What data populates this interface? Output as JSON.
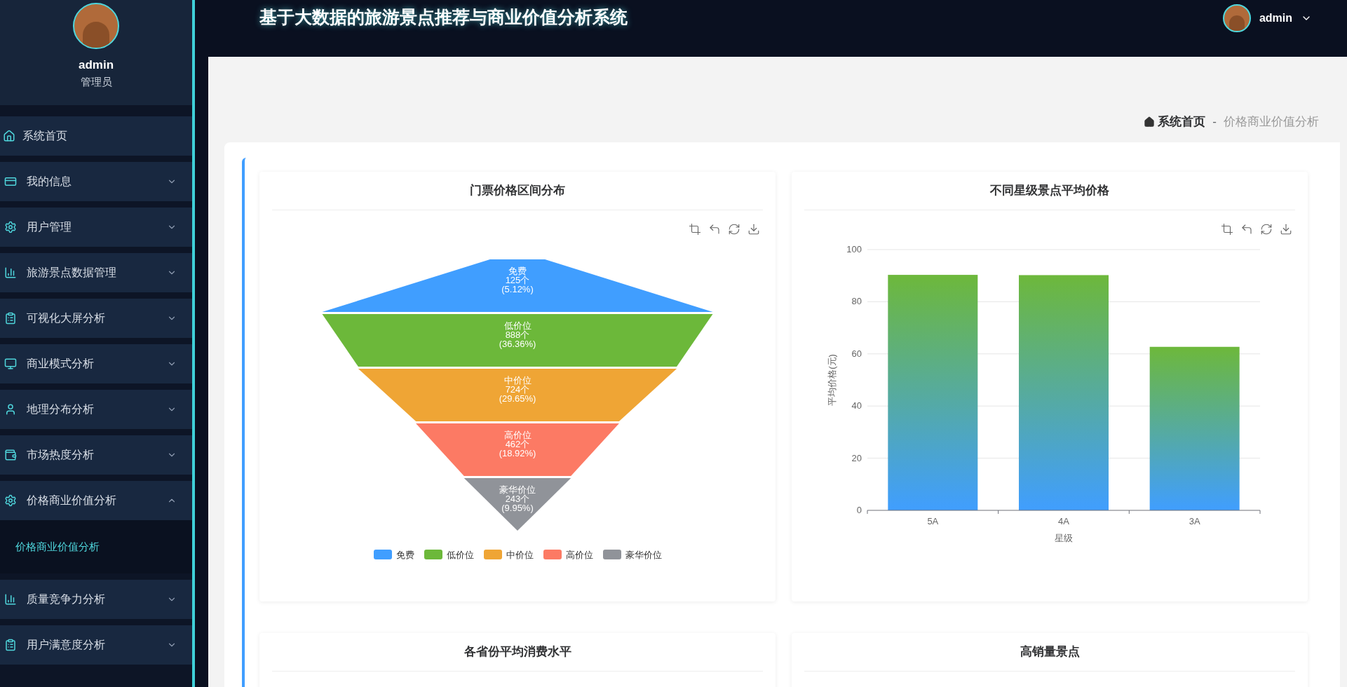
{
  "header": {
    "title": "基于大数据的旅游景点推荐与商业价值分析系统",
    "user": "admin"
  },
  "sidebar": {
    "user_name": "admin",
    "role": "管理员",
    "items": [
      {
        "label": "系统首页",
        "kind": "link"
      },
      {
        "label": "我的信息",
        "kind": "menu",
        "expanded": false
      },
      {
        "label": "用户管理",
        "kind": "menu",
        "expanded": false
      },
      {
        "label": "旅游景点数据管理",
        "kind": "menu",
        "expanded": false
      },
      {
        "label": "可视化大屏分析",
        "kind": "menu",
        "expanded": false
      },
      {
        "label": "商业模式分析",
        "kind": "menu",
        "expanded": false
      },
      {
        "label": "地理分布分析",
        "kind": "menu",
        "expanded": false
      },
      {
        "label": "市场热度分析",
        "kind": "menu",
        "expanded": false
      },
      {
        "label": "价格商业价值分析",
        "kind": "menu",
        "expanded": true,
        "children": [
          {
            "label": "价格商业价值分析",
            "selected": true
          }
        ]
      },
      {
        "label": "质量竞争力分析",
        "kind": "menu",
        "expanded": false
      },
      {
        "label": "用户满意度分析",
        "kind": "menu",
        "expanded": false
      }
    ]
  },
  "breadcrumb": {
    "home": "系统首页",
    "separator": "-",
    "current": "价格商业价值分析"
  },
  "panels": [
    {
      "kind": "funnel",
      "title": "门票价格区间分布",
      "funnel": [
        {
          "label": "免费",
          "count": "125个",
          "percent": "(5.12%)",
          "color": "#409eff"
        },
        {
          "label": "低价位",
          "count": "888个",
          "percent": "(36.36%)",
          "color": "#6cb83a"
        },
        {
          "label": "中价位",
          "count": "724个",
          "percent": "(29.65%)",
          "color": "#efa535"
        },
        {
          "label": "高价位",
          "count": "462个",
          "percent": "(18.92%)",
          "color": "#fc7a64"
        },
        {
          "label": "豪华价位",
          "count": "243个",
          "percent": "(9.95%)",
          "color": "#909399"
        }
      ],
      "legend": [
        {
          "label": "免费",
          "color": "#409eff"
        },
        {
          "label": "低价位",
          "color": "#6cb83a"
        },
        {
          "label": "中价位",
          "color": "#efa535"
        },
        {
          "label": "高价位",
          "color": "#fc7a64"
        },
        {
          "label": "豪华价位",
          "color": "#909399"
        }
      ]
    },
    {
      "kind": "bar",
      "title": "不同星级景点平均价格",
      "chart_data": {
        "type": "bar",
        "xlabel": "星级",
        "ylabel": "平均价格(元)",
        "categories": [
          "5A",
          "4A",
          "3A"
        ],
        "values": [
          90.3,
          90.2,
          62.7
        ],
        "ylim": [
          0,
          100
        ],
        "grid": true,
        "yticks": [
          0,
          20,
          40,
          60,
          80,
          100
        ]
      }
    },
    {
      "kind": "empty",
      "title": "各省份平均消费水平"
    },
    {
      "kind": "empty",
      "title": "高销量景点"
    }
  ]
}
